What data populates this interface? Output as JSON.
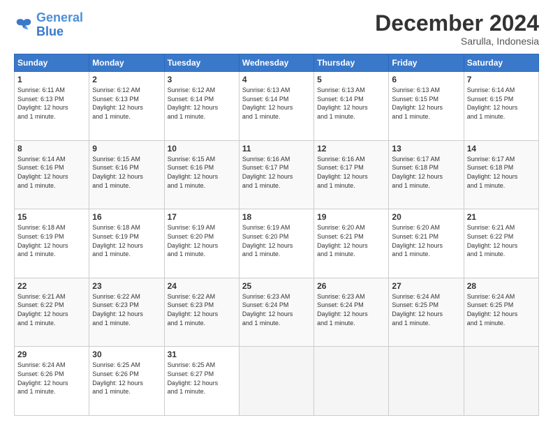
{
  "logo": {
    "text_general": "General",
    "text_blue": "Blue"
  },
  "header": {
    "month": "December 2024",
    "location": "Sarulla, Indonesia"
  },
  "weekdays": [
    "Sunday",
    "Monday",
    "Tuesday",
    "Wednesday",
    "Thursday",
    "Friday",
    "Saturday"
  ],
  "weeks": [
    [
      {
        "day": "1",
        "sunrise": "6:11 AM",
        "sunset": "6:13 PM",
        "daylight": "12 hours and 1 minute."
      },
      {
        "day": "2",
        "sunrise": "6:12 AM",
        "sunset": "6:13 PM",
        "daylight": "12 hours and 1 minute."
      },
      {
        "day": "3",
        "sunrise": "6:12 AM",
        "sunset": "6:14 PM",
        "daylight": "12 hours and 1 minute."
      },
      {
        "day": "4",
        "sunrise": "6:13 AM",
        "sunset": "6:14 PM",
        "daylight": "12 hours and 1 minute."
      },
      {
        "day": "5",
        "sunrise": "6:13 AM",
        "sunset": "6:14 PM",
        "daylight": "12 hours and 1 minute."
      },
      {
        "day": "6",
        "sunrise": "6:13 AM",
        "sunset": "6:15 PM",
        "daylight": "12 hours and 1 minute."
      },
      {
        "day": "7",
        "sunrise": "6:14 AM",
        "sunset": "6:15 PM",
        "daylight": "12 hours and 1 minute."
      }
    ],
    [
      {
        "day": "8",
        "sunrise": "6:14 AM",
        "sunset": "6:16 PM",
        "daylight": "12 hours and 1 minute."
      },
      {
        "day": "9",
        "sunrise": "6:15 AM",
        "sunset": "6:16 PM",
        "daylight": "12 hours and 1 minute."
      },
      {
        "day": "10",
        "sunrise": "6:15 AM",
        "sunset": "6:16 PM",
        "daylight": "12 hours and 1 minute."
      },
      {
        "day": "11",
        "sunrise": "6:16 AM",
        "sunset": "6:17 PM",
        "daylight": "12 hours and 1 minute."
      },
      {
        "day": "12",
        "sunrise": "6:16 AM",
        "sunset": "6:17 PM",
        "daylight": "12 hours and 1 minute."
      },
      {
        "day": "13",
        "sunrise": "6:17 AM",
        "sunset": "6:18 PM",
        "daylight": "12 hours and 1 minute."
      },
      {
        "day": "14",
        "sunrise": "6:17 AM",
        "sunset": "6:18 PM",
        "daylight": "12 hours and 1 minute."
      }
    ],
    [
      {
        "day": "15",
        "sunrise": "6:18 AM",
        "sunset": "6:19 PM",
        "daylight": "12 hours and 1 minute."
      },
      {
        "day": "16",
        "sunrise": "6:18 AM",
        "sunset": "6:19 PM",
        "daylight": "12 hours and 1 minute."
      },
      {
        "day": "17",
        "sunrise": "6:19 AM",
        "sunset": "6:20 PM",
        "daylight": "12 hours and 1 minute."
      },
      {
        "day": "18",
        "sunrise": "6:19 AM",
        "sunset": "6:20 PM",
        "daylight": "12 hours and 1 minute."
      },
      {
        "day": "19",
        "sunrise": "6:20 AM",
        "sunset": "6:21 PM",
        "daylight": "12 hours and 1 minute."
      },
      {
        "day": "20",
        "sunrise": "6:20 AM",
        "sunset": "6:21 PM",
        "daylight": "12 hours and 1 minute."
      },
      {
        "day": "21",
        "sunrise": "6:21 AM",
        "sunset": "6:22 PM",
        "daylight": "12 hours and 1 minute."
      }
    ],
    [
      {
        "day": "22",
        "sunrise": "6:21 AM",
        "sunset": "6:22 PM",
        "daylight": "12 hours and 1 minute."
      },
      {
        "day": "23",
        "sunrise": "6:22 AM",
        "sunset": "6:23 PM",
        "daylight": "12 hours and 1 minute."
      },
      {
        "day": "24",
        "sunrise": "6:22 AM",
        "sunset": "6:23 PM",
        "daylight": "12 hours and 1 minute."
      },
      {
        "day": "25",
        "sunrise": "6:23 AM",
        "sunset": "6:24 PM",
        "daylight": "12 hours and 1 minute."
      },
      {
        "day": "26",
        "sunrise": "6:23 AM",
        "sunset": "6:24 PM",
        "daylight": "12 hours and 1 minute."
      },
      {
        "day": "27",
        "sunrise": "6:24 AM",
        "sunset": "6:25 PM",
        "daylight": "12 hours and 1 minute."
      },
      {
        "day": "28",
        "sunrise": "6:24 AM",
        "sunset": "6:25 PM",
        "daylight": "12 hours and 1 minute."
      }
    ],
    [
      {
        "day": "29",
        "sunrise": "6:24 AM",
        "sunset": "6:26 PM",
        "daylight": "12 hours and 1 minute."
      },
      {
        "day": "30",
        "sunrise": "6:25 AM",
        "sunset": "6:26 PM",
        "daylight": "12 hours and 1 minute."
      },
      {
        "day": "31",
        "sunrise": "6:25 AM",
        "sunset": "6:27 PM",
        "daylight": "12 hours and 1 minute."
      },
      null,
      null,
      null,
      null
    ]
  ],
  "labels": {
    "sunrise": "Sunrise: ",
    "sunset": "Sunset: ",
    "daylight": "Daylight: "
  }
}
